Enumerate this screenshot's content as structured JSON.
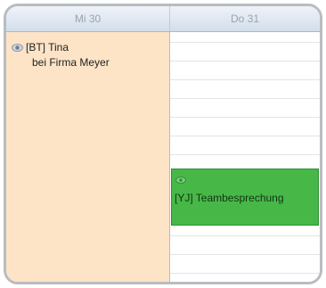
{
  "calendar": {
    "days": [
      {
        "label": "Mi 30"
      },
      {
        "label": "Do 31"
      }
    ],
    "events": [
      {
        "day": "Mi 30",
        "icon": "eye-icon",
        "line1": "[BT] Tina",
        "line2": "bei Firma Meyer",
        "color": "#fde4c6"
      },
      {
        "day": "Do 31",
        "icon": "eye-icon",
        "line1": "[YJ] Teambesprechung",
        "color": "#47b848"
      }
    ]
  }
}
